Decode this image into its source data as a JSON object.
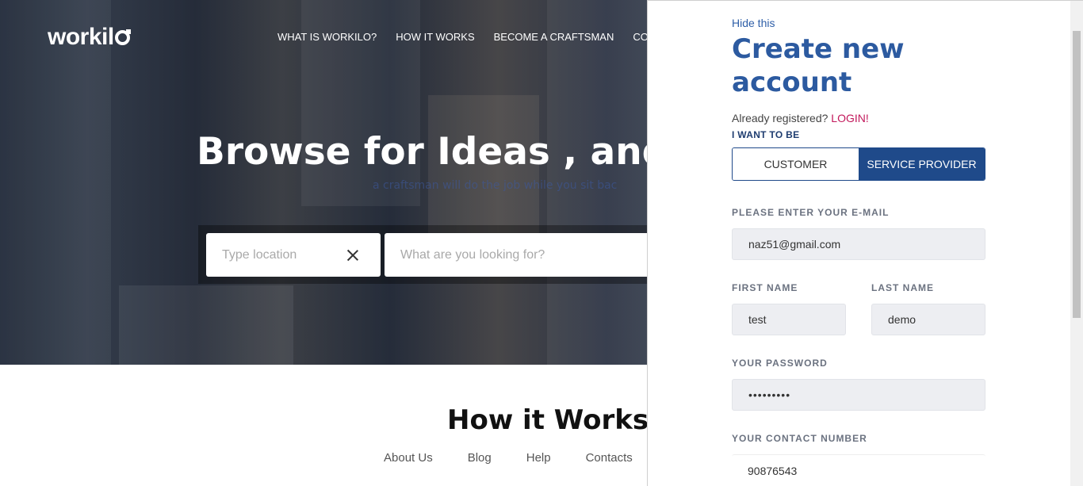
{
  "header": {
    "logo_text": "workil",
    "nav": [
      "WHAT IS WORKILO?",
      "HOW IT WORKS",
      "BECOME A CRAFTSMAN",
      "COMM"
    ]
  },
  "hero": {
    "title": "Browse for Ideas , and B",
    "subtitle": "a craftsman will do the job while you sit bac",
    "location_placeholder": "Type location",
    "search_placeholder": "What are you looking for?"
  },
  "section": {
    "how_title": "How it Works"
  },
  "footer": {
    "links": [
      "About Us",
      "Blog",
      "Help",
      "Contacts"
    ]
  },
  "signup": {
    "hide_label": "Hide this",
    "title_line1": "Create new",
    "title_line2": "account",
    "already_text": "Already registered?",
    "login_label": "LOGIN!",
    "want_label": "I WANT TO BE",
    "role_customer": "CUSTOMER",
    "role_provider": "SERVICE PROVIDER",
    "email_label": "PLEASE ENTER YOUR E-MAIL",
    "email_value": "naz51@gmail.com",
    "first_name_label": "FIRST NAME",
    "first_name_value": "test",
    "last_name_label": "LAST NAME",
    "last_name_value": "demo",
    "password_label": "YOUR PASSWORD",
    "password_value": "•••••••••",
    "contact_label": "YOUR CONTACT NUMBER",
    "contact_value": "90876543"
  },
  "colors": {
    "accent": "#2c5aa0",
    "toggle_active": "#1f4a8a",
    "login_link": "#c2185b"
  }
}
